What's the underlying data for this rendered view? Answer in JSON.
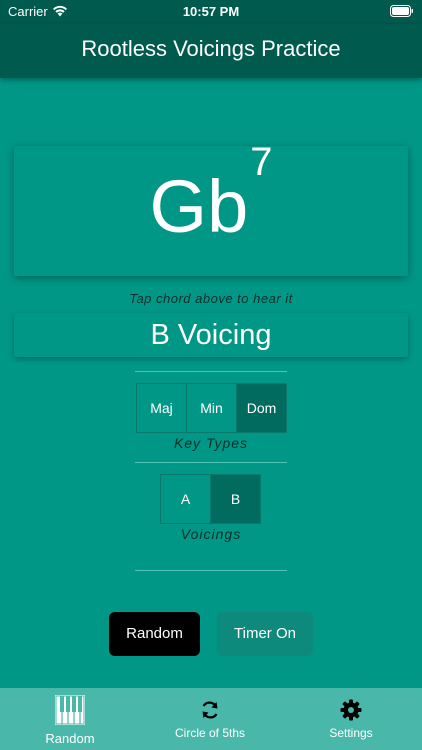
{
  "status": {
    "carrier": "Carrier",
    "time": "10:57 PM"
  },
  "nav": {
    "title": "Rootless Voicings Practice"
  },
  "chord": {
    "root": "Gb",
    "extension": "7",
    "hint": "Tap chord above to hear it"
  },
  "voicing_display": "B Voicing",
  "key_types": {
    "label": "Key Types",
    "options": [
      "Maj",
      "Min",
      "Dom"
    ],
    "selected": "Dom"
  },
  "voicings": {
    "label": "Voicings",
    "options": [
      "A",
      "B"
    ],
    "selected": "B"
  },
  "buttons": {
    "random": "Random",
    "timer": "Timer On"
  },
  "tabs": [
    {
      "label": "Random",
      "icon": "piano-icon",
      "selected": true
    },
    {
      "label": "Circle of 5ths",
      "icon": "refresh-icon"
    },
    {
      "label": "Settings",
      "icon": "gear-icon"
    }
  ],
  "colors": {
    "background": "#019787",
    "nav": "#005a4e",
    "selected": "#026b5f",
    "tabbar": "#49b8aa"
  }
}
